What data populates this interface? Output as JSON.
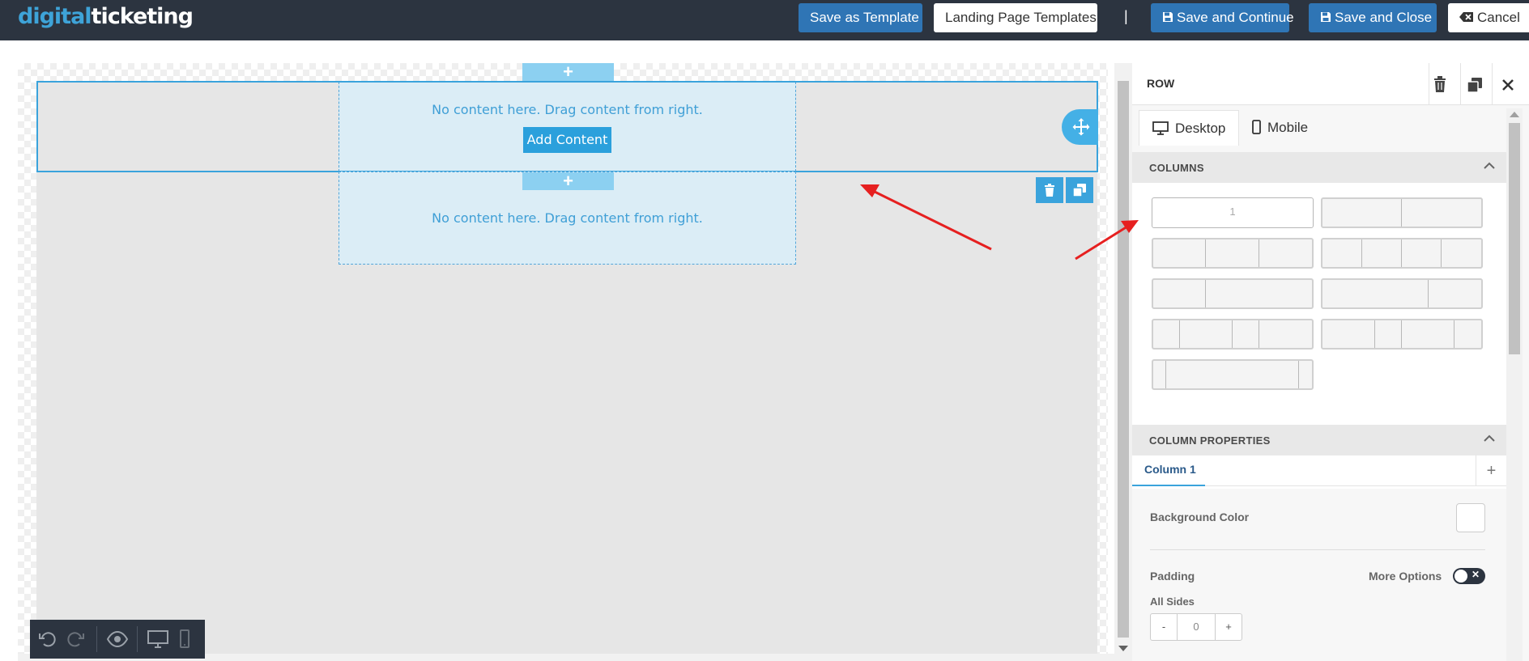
{
  "topbar": {
    "logo_part1": "digital",
    "logo_part2": "ticketing",
    "save_template_label": "Save as Template",
    "landing_templates_label": "Landing Page Templates",
    "separator": "|",
    "save_continue_label": "Save and Continue",
    "save_close_label": "Save and Close",
    "cancel_label": "Cancel"
  },
  "canvas": {
    "empty_message_1": "No content here. Drag content from right.",
    "empty_message_2": "No content here. Drag content from right.",
    "add_content_label": "Add Content",
    "plus_symbol": "+"
  },
  "panel": {
    "title": "ROW",
    "tabs": [
      "Desktop",
      "Mobile"
    ],
    "columns_title": "COLUMNS",
    "layouts": [
      {
        "label": "1",
        "selected": true
      },
      {
        "label": "",
        "selected": false
      },
      {
        "label": "",
        "selected": false
      },
      {
        "label": "",
        "selected": false
      },
      {
        "label": "",
        "selected": false
      },
      {
        "label": "",
        "selected": false
      },
      {
        "label": "",
        "selected": false
      },
      {
        "label": "",
        "selected": false
      },
      {
        "label": "",
        "selected": false
      }
    ],
    "column_properties_title": "COLUMN PROPERTIES",
    "column_tab": "Column 1",
    "column_add": "+",
    "background_color_label": "Background Color",
    "background_color_value": "#ffffff",
    "padding_label": "Padding",
    "more_options_label": "More Options",
    "more_options_on": false,
    "all_sides_label": "All Sides",
    "padding_minus": "-",
    "padding_value": "0",
    "padding_plus": "+"
  },
  "colors": {
    "topbar_bg": "#2c3440",
    "accent": "#3aa3dc",
    "button_blue": "#2f75b5",
    "annotation_arrow": "#e62020"
  }
}
